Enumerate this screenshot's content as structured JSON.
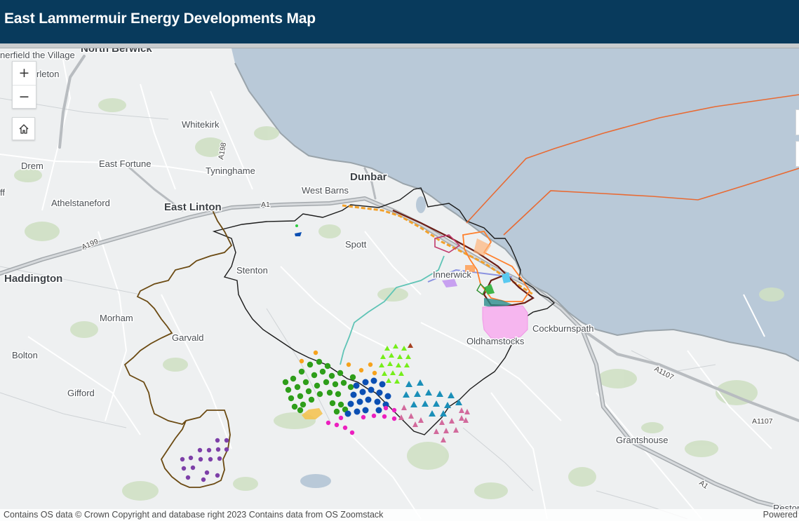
{
  "header": {
    "title": "East Lammermuir Energy Developments Map"
  },
  "map": {
    "places": {
      "dunbar": "Dunbar",
      "east_linton": "East Linton",
      "haddington": "Haddington",
      "whitekirk": "Whitekirk",
      "tyninghame": "Tyninghame",
      "drem": "Drem",
      "east_fortune": "East Fortune",
      "athelstaneford": "Athelstaneford",
      "west_barns": "West Barns",
      "spott": "Spott",
      "stenton": "Stenton",
      "innerwick": "Innerwick",
      "morham": "Morham",
      "garvald": "Garvald",
      "bolton": "Bolton",
      "gifford": "Gifford",
      "oldhamstocks": "Oldhamstocks",
      "cockburnspath": "Cockburnspath",
      "grantshouse": "Grantshouse",
      "reston": "Reston",
      "north_berwick": "North Berwick",
      "somerfield": "nerfield the Village",
      "aberlady": "rleton",
      "ff": "ff"
    },
    "roads": {
      "a1_a": "A1",
      "a1_b": "A1",
      "a199": "A199",
      "a198": "A198",
      "a1107_a": "A1107",
      "a1107_b": "A1107"
    }
  },
  "controls": {
    "zoom_in": "+",
    "zoom_out": "−",
    "home_icon": "home-icon"
  },
  "footer": {
    "attribution": "Contains OS data © Crown Copyright and database right 2023 Contains data from OS Zoomstack",
    "powered": "Powered"
  },
  "colors": {
    "header": "#083a5c",
    "sea": "#b9c9d8",
    "land": "#eef0f1",
    "boundary": "#1a1a1a",
    "brown_boundary": "#6b4a12",
    "offshore_cable": "#e86a33"
  }
}
